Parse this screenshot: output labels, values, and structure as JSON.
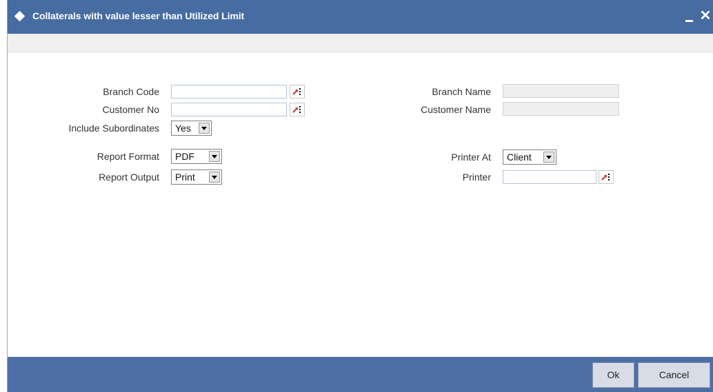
{
  "window": {
    "title": "Collaterals with value lesser than Utilized Limit"
  },
  "form": {
    "branch_code": {
      "label": "Branch Code",
      "value": ""
    },
    "customer_no": {
      "label": "Customer No",
      "value": ""
    },
    "include_subordinates": {
      "label": "Include Subordinates",
      "value": "Yes"
    },
    "branch_name": {
      "label": "Branch Name",
      "value": ""
    },
    "customer_name": {
      "label": "Customer Name",
      "value": ""
    },
    "report_format": {
      "label": "Report Format",
      "value": "PDF"
    },
    "report_output": {
      "label": "Report Output",
      "value": "Print"
    },
    "printer_at": {
      "label": "Printer At",
      "value": "Client"
    },
    "printer": {
      "label": "Printer",
      "value": ""
    }
  },
  "footer": {
    "ok_label": "Ok",
    "cancel_label": "Cancel"
  },
  "colors": {
    "titlebar": "#466ca2",
    "footer": "#4e6fa6"
  },
  "icons": [
    "diamond-icon",
    "minimize-icon",
    "close-icon",
    "lov-icon",
    "chevron-down-icon"
  ]
}
